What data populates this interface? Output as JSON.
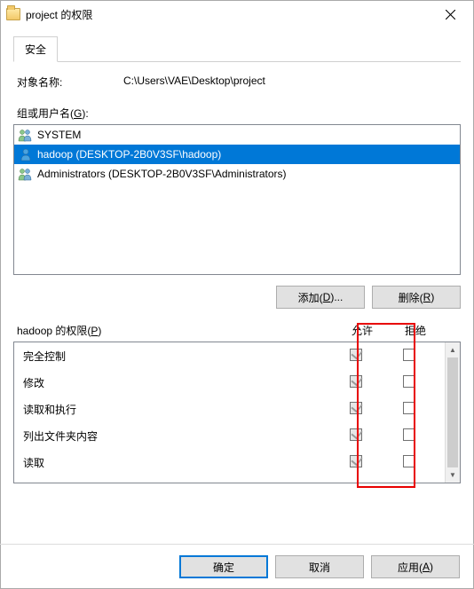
{
  "window": {
    "title": "project 的权限"
  },
  "tab": {
    "security": "安全"
  },
  "labels": {
    "object_name": "对象名称:",
    "object_path": "C:\\Users\\VAE\\Desktop\\project",
    "groups_label_pre": "组或用户名(",
    "groups_hotkey": "G",
    "groups_label_post": "):"
  },
  "users": [
    {
      "name": "SYSTEM",
      "selected": false,
      "type": "group"
    },
    {
      "name": "hadoop (DESKTOP-2B0V3SF\\hadoop)",
      "selected": true,
      "type": "user"
    },
    {
      "name": "Administrators (DESKTOP-2B0V3SF\\Administrators)",
      "selected": false,
      "type": "group"
    }
  ],
  "buttons": {
    "add_pre": "添加(",
    "add_hk": "D",
    "add_post": ")...",
    "remove_pre": "删除(",
    "remove_hk": "R",
    "remove_post": ")",
    "ok": "确定",
    "cancel": "取消",
    "apply_pre": "应用(",
    "apply_hk": "A",
    "apply_post": ")"
  },
  "perm_header": {
    "title_pre": "hadoop 的权限(",
    "title_hk": "P",
    "title_post": ")",
    "allow": "允许",
    "deny": "拒绝"
  },
  "permissions": [
    {
      "name": "完全控制",
      "allow_checked": true,
      "allow_disabled": true,
      "deny_checked": false
    },
    {
      "name": "修改",
      "allow_checked": true,
      "allow_disabled": true,
      "deny_checked": false
    },
    {
      "name": "读取和执行",
      "allow_checked": true,
      "allow_disabled": true,
      "deny_checked": false
    },
    {
      "name": "列出文件夹内容",
      "allow_checked": true,
      "allow_disabled": true,
      "deny_checked": false
    },
    {
      "name": "读取",
      "allow_checked": true,
      "allow_disabled": true,
      "deny_checked": false
    }
  ]
}
